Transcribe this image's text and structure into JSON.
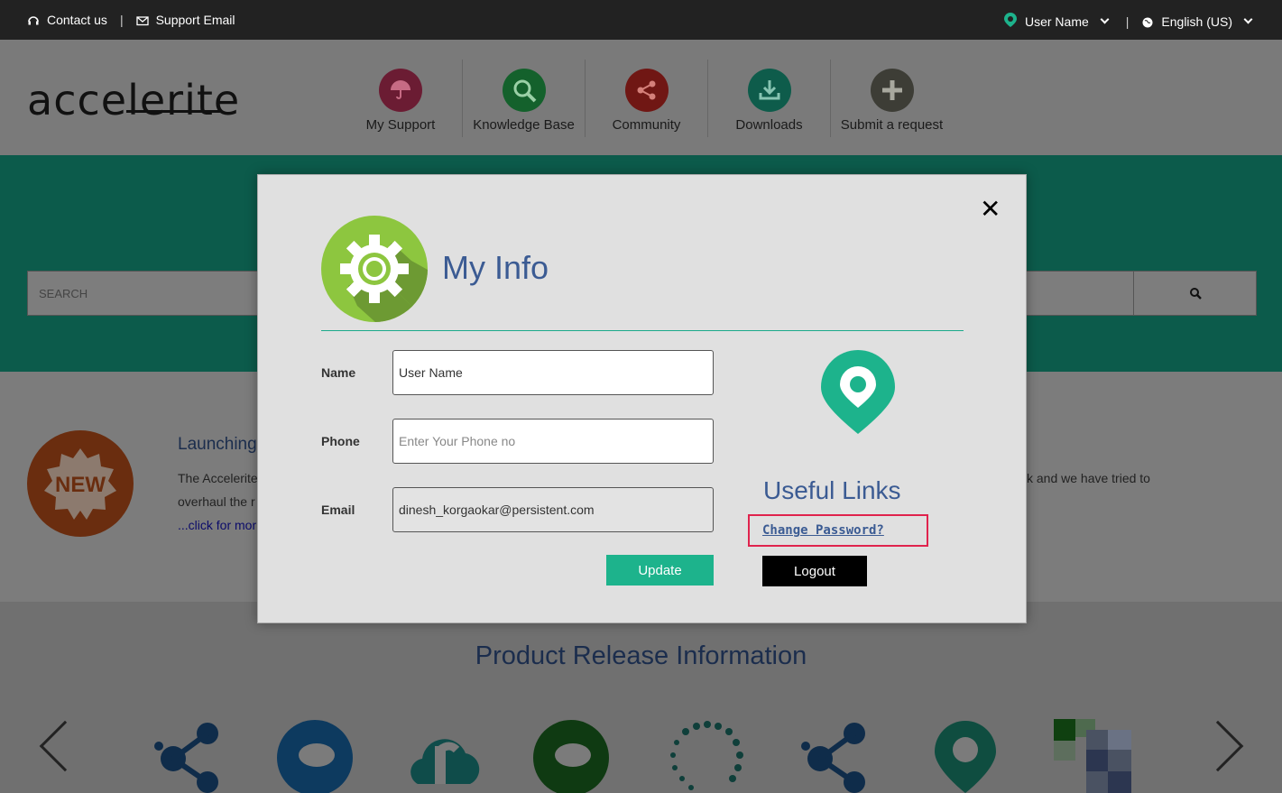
{
  "topbar": {
    "contact_label": "Contact us",
    "support_email_label": "Support Email",
    "user_name": "User Name",
    "language": "English (US)"
  },
  "header": {
    "logo_text": "accelerite",
    "nav": [
      {
        "label": "My Support",
        "icon": "umbrella-icon",
        "color": "#6b1c33"
      },
      {
        "label": "Knowledge Base",
        "icon": "search-icon",
        "color": "#14612c"
      },
      {
        "label": "Community",
        "icon": "share-icon",
        "color": "#701714"
      },
      {
        "label": "Downloads",
        "icon": "download-icon",
        "color": "#0e5c4b"
      },
      {
        "label": "Submit a request",
        "icon": "plus-icon",
        "color": "#3d3d36"
      }
    ]
  },
  "banner": {
    "search_placeholder": "SEARCH"
  },
  "launch": {
    "badge_text": "NEW",
    "title": "Launching",
    "text_line1": "The Accelerite",
    "text_line2": "overhaul the r",
    "link_text": "...click for mor",
    "text_right": "k and we have tried to"
  },
  "products": {
    "title": "Product Release Information"
  },
  "modal": {
    "title": "My Info",
    "name_label": "Name",
    "name_value": "User Name",
    "phone_label": "Phone",
    "phone_placeholder": "Enter Your Phone no",
    "email_label": "Email",
    "email_value": "dinesh_korgaokar@persistent.com",
    "update_label": "Update",
    "useful_links_title": "Useful Links",
    "change_password_label": "Change Password?",
    "logout_label": "Logout"
  },
  "colors": {
    "accent": "#1db38c",
    "title_blue": "#3b5b93",
    "highlight_red": "#e0234d"
  }
}
